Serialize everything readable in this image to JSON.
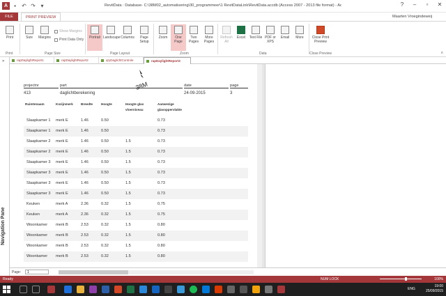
{
  "titlebar": {
    "app_icon": "A",
    "title": "RevitData : Database- C:\\38M02_automatisering\\30_programmeer\\1 RevitDataLink\\RevitData.accdb (Access 2007 - 2013 file format) - Access",
    "help": "?",
    "user": "Maarten Vroegindeweij"
  },
  "tabs": {
    "file": "FILE",
    "print_preview": "PRINT PREVIEW"
  },
  "ribbon": {
    "print": "Print",
    "size": "Size",
    "margins": "Margins",
    "show_margins": "Show Margins",
    "print_data_only": "Print Data Only",
    "portrait": "Portrait",
    "landscape": "Landscape",
    "columns": "Columns",
    "page_setup": "Page Setup",
    "zoom": "Zoom",
    "one_page": "One Page",
    "two_pages": "Two Pages",
    "more_pages": "More Pages",
    "refresh_all": "Refresh All",
    "excel": "Excel",
    "text_file": "Text File",
    "pdf_xps": "PDF or XPS",
    "email": "Email",
    "more": "More",
    "close_print_preview": "Close Print Preview",
    "groups": {
      "print": "Print",
      "page_size": "Page Size",
      "page_layout": "Page Layout",
      "zoom": "Zoom",
      "data": "Data",
      "close_preview": "Close Preview"
    }
  },
  "nav_pane": {
    "label": "Navigation Pane"
  },
  "doc_tabs": [
    {
      "label": "rapDaylightReport1"
    },
    {
      "label": "rapDaylightReport2"
    },
    {
      "label": "qryDaglichtControle"
    },
    {
      "label": "rapDaylightReport3"
    }
  ],
  "report": {
    "logo_text": "38M",
    "header": {
      "projectnr_label": "projectnr",
      "part_label": "part",
      "date_label": "date",
      "page_label": "page",
      "projectnr": "413",
      "part": "daglichtberekening",
      "date": "24-09-2015",
      "page": "3"
    },
    "columns": [
      "Ruimtenaam",
      "Kozijnmerk",
      "Breedte",
      "Hoogte",
      "Hoogte glas",
      "vloerniveau",
      "Aanwezige",
      "glasoppervlakte"
    ],
    "rows": [
      {
        "name": "Slaapkamer 1",
        "merk": "merk E",
        "breedte": "1.46",
        "hoogte": "0.50",
        "vloer": "",
        "glas": "0.73"
      },
      {
        "name": "Slaapkamer 1",
        "merk": "merk E",
        "breedte": "1.46",
        "hoogte": "0.50",
        "vloer": "",
        "glas": "0.73"
      },
      {
        "name": "Slaapkamer 2",
        "merk": "merk E",
        "breedte": "1.46",
        "hoogte": "0.50",
        "vloer": "1.5",
        "glas": "0.73"
      },
      {
        "name": "Slaapkamer 2",
        "merk": "merk E",
        "breedte": "1.46",
        "hoogte": "0.50",
        "vloer": "1.5",
        "glas": "0.73"
      },
      {
        "name": "Slaapkamer 3",
        "merk": "merk E",
        "breedte": "1.46",
        "hoogte": "0.50",
        "vloer": "1.5",
        "glas": "0.73"
      },
      {
        "name": "Slaapkamer 3",
        "merk": "merk E",
        "breedte": "1.46",
        "hoogte": "0.50",
        "vloer": "1.5",
        "glas": "0.73"
      },
      {
        "name": "Slaapkamer 3",
        "merk": "merk E",
        "breedte": "1.46",
        "hoogte": "0.50",
        "vloer": "1.5",
        "glas": "0.73"
      },
      {
        "name": "Slaapkamer 3",
        "merk": "merk E",
        "breedte": "1.46",
        "hoogte": "0.50",
        "vloer": "1.5",
        "glas": "0.73"
      },
      {
        "name": "Keuken",
        "merk": "merk A",
        "breedte": "2.36",
        "hoogte": "0.32",
        "vloer": "1.5",
        "glas": "0.75"
      },
      {
        "name": "Keuken",
        "merk": "merk A",
        "breedte": "2.36",
        "hoogte": "0.32",
        "vloer": "1.5",
        "glas": "0.75"
      },
      {
        "name": "Woonkamer",
        "merk": "merk B",
        "breedte": "2.53",
        "hoogte": "0.32",
        "vloer": "1.5",
        "glas": "0.80"
      },
      {
        "name": "Woonkamer",
        "merk": "merk B",
        "breedte": "2.53",
        "hoogte": "0.32",
        "vloer": "1.5",
        "glas": "0.80"
      },
      {
        "name": "Woonkamer",
        "merk": "merk B",
        "breedte": "2.53",
        "hoogte": "0.32",
        "vloer": "1.5",
        "glas": "0.80"
      },
      {
        "name": "Woonkamer",
        "merk": "merk B",
        "breedte": "2.53",
        "hoogte": "0.32",
        "vloer": "1.5",
        "glas": "0.80"
      }
    ]
  },
  "record_nav": {
    "label": "Page:",
    "value": "1"
  },
  "statusbar": {
    "ready": "Ready",
    "numlock": "NUM LOCK",
    "zoom": "100%"
  },
  "taskbar": {
    "lang": "ENG",
    "time": "19:00",
    "date": "25/09/2015"
  },
  "colors": {
    "accent": "#a4373a",
    "taskbar": "#1f1f1f"
  }
}
